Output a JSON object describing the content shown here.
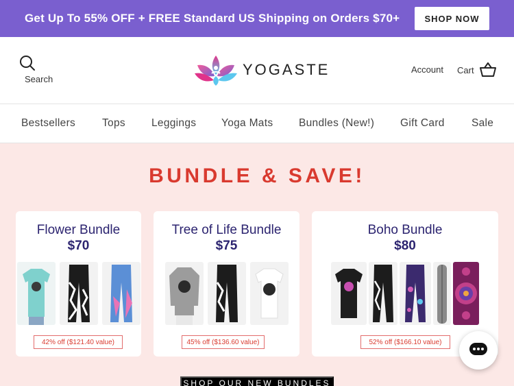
{
  "promo": {
    "text": "Get Up To 55% OFF + FREE Standard US Shipping on Orders $70+",
    "button": "SHOP NOW",
    "bg_color": "#7a5fcf"
  },
  "header": {
    "search_label": "Search",
    "logo_text": "YOGASTE",
    "account_label": "Account",
    "cart_label": "Cart"
  },
  "nav": {
    "items": [
      "Bestsellers",
      "Tops",
      "Leggings",
      "Yoga Mats",
      "Bundles (New!)",
      "Gift Card",
      "Sale"
    ]
  },
  "hero": {
    "title": "BUNDLE & SAVE!",
    "title_color": "#d93a2f"
  },
  "bundles": [
    {
      "name": "Flower Bundle",
      "price": "$70",
      "badge": "42% off ($121.40 value)"
    },
    {
      "name": "Tree of Life Bundle",
      "price": "$75",
      "badge": "45% off ($136.60 value)"
    },
    {
      "name": "Boho Bundle",
      "price": "$80",
      "badge": "52% off ($166.10 value)"
    }
  ],
  "cta": {
    "label": "SHOP OUR NEW BUNDLES"
  },
  "icons": [
    "search-icon",
    "logo-lotus-icon",
    "cart-icon",
    "chat-icon"
  ]
}
